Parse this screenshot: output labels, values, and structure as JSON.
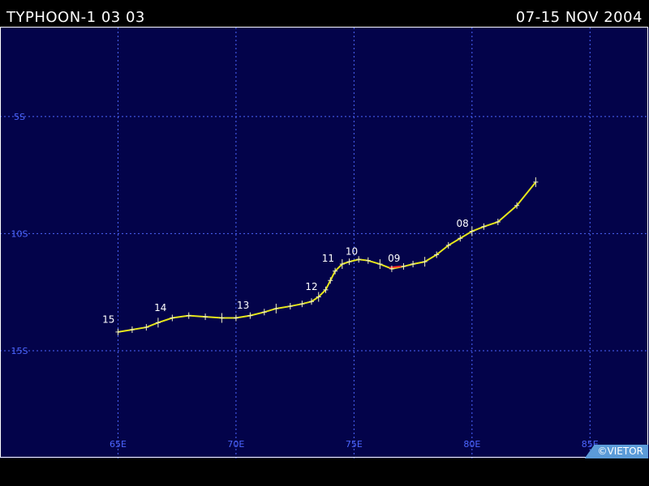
{
  "header": {
    "title": "TYPHOON-1 03 03",
    "dates": "07-15 NOV 2004"
  },
  "credit": "©VIETOR",
  "map": {
    "background": "#03034a",
    "grid_color": "#4d66ff",
    "track_color": "#e6e61a",
    "lon_range": [
      60,
      87.5
    ],
    "lat_range": [
      -1.2,
      -19.6
    ],
    "lon_labels": [
      {
        "lon": 65,
        "text": "65E"
      },
      {
        "lon": 70,
        "text": "70E"
      },
      {
        "lon": 75,
        "text": "75E"
      },
      {
        "lon": 80,
        "text": "80E"
      },
      {
        "lon": 85,
        "text": "85E"
      }
    ],
    "lat_labels": [
      {
        "lat": -5,
        "text": "5S"
      },
      {
        "lat": -10,
        "text": "10S"
      },
      {
        "lat": -15,
        "text": "15S"
      }
    ],
    "track": [
      {
        "lon": 82.7,
        "lat": -7.8
      },
      {
        "lon": 81.9,
        "lat": -8.8
      },
      {
        "lon": 81.1,
        "lat": -9.5
      },
      {
        "lon": 80.5,
        "lat": -9.7
      },
      {
        "lon": 80.0,
        "lat": -9.9
      },
      {
        "lon": 79.5,
        "lat": -10.2
      },
      {
        "lon": 79.0,
        "lat": -10.5
      },
      {
        "lon": 78.5,
        "lat": -10.9
      },
      {
        "lon": 78.0,
        "lat": -11.2
      },
      {
        "lon": 77.5,
        "lat": -11.3
      },
      {
        "lon": 77.1,
        "lat": -11.4
      },
      {
        "lon": 76.6,
        "lat": -11.5
      },
      {
        "lon": 76.1,
        "lat": -11.3
      },
      {
        "lon": 75.6,
        "lat": -11.15
      },
      {
        "lon": 75.2,
        "lat": -11.1
      },
      {
        "lon": 74.8,
        "lat": -11.2
      },
      {
        "lon": 74.5,
        "lat": -11.3
      },
      {
        "lon": 74.2,
        "lat": -11.6
      },
      {
        "lon": 74.0,
        "lat": -12.0
      },
      {
        "lon": 73.8,
        "lat": -12.4
      },
      {
        "lon": 73.5,
        "lat": -12.7
      },
      {
        "lon": 73.2,
        "lat": -12.9
      },
      {
        "lon": 72.8,
        "lat": -13.0
      },
      {
        "lon": 72.3,
        "lat": -13.1
      },
      {
        "lon": 71.7,
        "lat": -13.2
      },
      {
        "lon": 71.2,
        "lat": -13.35
      },
      {
        "lon": 70.6,
        "lat": -13.5
      },
      {
        "lon": 70.0,
        "lat": -13.6
      },
      {
        "lon": 69.4,
        "lat": -13.6
      },
      {
        "lon": 68.7,
        "lat": -13.55
      },
      {
        "lon": 68.0,
        "lat": -13.5
      },
      {
        "lon": 67.3,
        "lat": -13.6
      },
      {
        "lon": 66.7,
        "lat": -13.8
      },
      {
        "lon": 66.2,
        "lat": -14.0
      },
      {
        "lon": 65.6,
        "lat": -14.1
      },
      {
        "lon": 65.0,
        "lat": -14.2
      }
    ],
    "red_segment": [
      {
        "lon": 76.5,
        "lat": -11.45
      },
      {
        "lon": 77.0,
        "lat": -11.4
      }
    ],
    "day_labels": [
      {
        "text": "08",
        "lon": 79.6,
        "lat": -9.7
      },
      {
        "text": "09",
        "lon": 76.7,
        "lat": -11.2
      },
      {
        "text": "10",
        "lon": 74.9,
        "lat": -10.9
      },
      {
        "text": "11",
        "lon": 73.9,
        "lat": -11.2
      },
      {
        "text": "12",
        "lon": 73.2,
        "lat": -12.4
      },
      {
        "text": "13",
        "lon": 70.3,
        "lat": -13.2
      },
      {
        "text": "14",
        "lon": 66.8,
        "lat": -13.3
      },
      {
        "text": "15",
        "lon": 64.6,
        "lat": -13.8
      }
    ]
  }
}
